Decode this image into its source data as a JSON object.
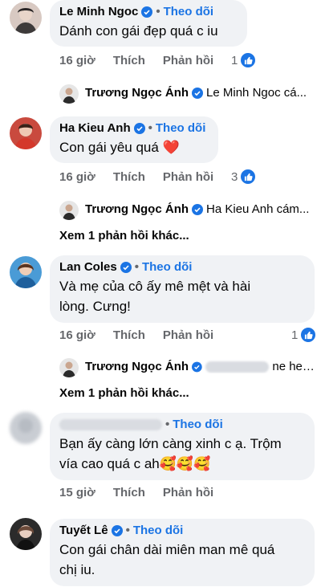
{
  "follow_label": "Theo dõi",
  "actions": {
    "like": "Thích",
    "reply": "Phản hồi"
  },
  "more_replies": "Xem 1 phản hồi khác...",
  "comments": [
    {
      "author": "Le Minh Ngoc",
      "text": "Dánh con gái đẹp quá c iu",
      "time": "16 giờ",
      "likes": "1",
      "reply": {
        "author": "Trương Ngọc Ánh",
        "preview": "Le Minh Ngoc cá..."
      }
    },
    {
      "author": "Ha Kieu Anh",
      "text": "Con gái yêu quá ❤️",
      "time": "16 giờ",
      "likes": "3",
      "reply": {
        "author": "Trương Ngọc Ánh",
        "preview": "Ha Kieu Anh cám..."
      }
    },
    {
      "author": "Lan Coles",
      "text_line1": "Và mẹ của cô ấy mê mệt và hài",
      "text_line2": "lòng. Cưng!",
      "time": "16 giờ",
      "likes": "1",
      "reply": {
        "author": "Trương Ngọc Ánh",
        "preview": "ne he d..."
      }
    },
    {
      "author": "",
      "text_line1": "Bạn ấy càng lớn càng xinh c ạ. Trộm",
      "text_line2": "vía cao quá c ah🥰🥰🥰",
      "time": "15 giờ"
    },
    {
      "author": "Tuyết Lê",
      "text_line1": "Con gái chân dài miên man mê quá",
      "text_line2": "chị iu."
    }
  ],
  "colors": {
    "link": "#1b74e4",
    "bubble": "#f0f2f5",
    "muted": "#65676b"
  }
}
